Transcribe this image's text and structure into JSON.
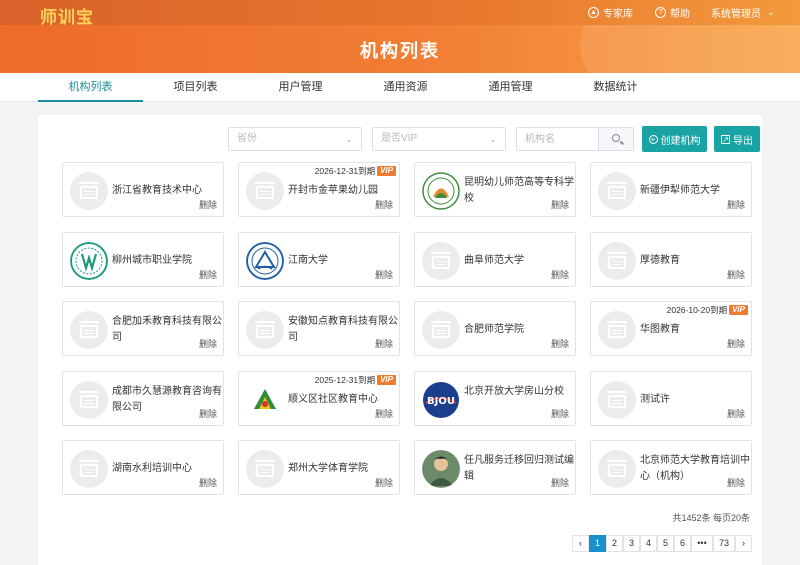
{
  "header": {
    "logo": "师训宝",
    "expert_label": "专家库",
    "help_label": "帮助",
    "admin_label": "系统管理员"
  },
  "banner": {
    "title": "机构列表"
  },
  "tabs": [
    {
      "label": "机构列表",
      "active": true
    },
    {
      "label": "项目列表"
    },
    {
      "label": "用户管理"
    },
    {
      "label": "通用资源"
    },
    {
      "label": "通用管理"
    },
    {
      "label": "数据统计"
    }
  ],
  "filters": {
    "province_placeholder": "省份",
    "vip_placeholder": "是否VIP",
    "name_placeholder": "机构名",
    "create_label": "创建机构",
    "export_label": "导出"
  },
  "cards": [
    {
      "name": "浙江省教育技术中心",
      "logo": "placeholder"
    },
    {
      "name": "开封市金苹果幼儿园",
      "logo": "placeholder",
      "vip_date": "2026-12-31到期"
    },
    {
      "name": "昆明幼儿师范高等专科学校",
      "logo": "kunming"
    },
    {
      "name": "新疆伊犁师范大学",
      "logo": "placeholder"
    },
    {
      "name": "柳州城市职业学院",
      "logo": "liuzhou"
    },
    {
      "name": "江南大学",
      "logo": "jiangnan"
    },
    {
      "name": "曲阜师范大学",
      "logo": "placeholder"
    },
    {
      "name": "厚德教育",
      "logo": "placeholder"
    },
    {
      "name": "合肥加禾教育科技有限公司",
      "logo": "placeholder"
    },
    {
      "name": "安徽知点教育科技有限公司",
      "logo": "placeholder"
    },
    {
      "name": "合肥师范学院",
      "logo": "placeholder"
    },
    {
      "name": "华图教育",
      "logo": "placeholder",
      "vip_date": "2026-10-20到期"
    },
    {
      "name": "成都市久慧源教育咨询有限公司",
      "logo": "placeholder"
    },
    {
      "name": "顺义区社区教育中心",
      "logo": "shunyi",
      "vip_date": "2025-12-31到期"
    },
    {
      "name": "北京开放大学房山分校",
      "logo": "bjou"
    },
    {
      "name": "测试许",
      "logo": "placeholder"
    },
    {
      "name": "湖南水利培训中心",
      "logo": "placeholder"
    },
    {
      "name": "郑州大学体育学院",
      "logo": "placeholder"
    },
    {
      "name": "任凡服务迁移回归测试编辑",
      "logo": "avatar"
    },
    {
      "name": "北京师范大学教育培训中心（机构）",
      "logo": "placeholder"
    }
  ],
  "card_labels": {
    "delete": "删除",
    "vip": "VIP"
  },
  "pagination": {
    "total_text": "共1452条 每页20条",
    "pages": [
      "1",
      "2",
      "3",
      "4",
      "5",
      "6",
      "•••",
      "73"
    ],
    "current": "1",
    "prev": "‹",
    "next": "›"
  },
  "logo_text": {
    "bjou": "BJOU"
  },
  "colors": {
    "accent": "#1aa3a3",
    "vip": "#f07b2e",
    "page_active": "#1890c9",
    "tab_active": "#1a8d9a"
  }
}
